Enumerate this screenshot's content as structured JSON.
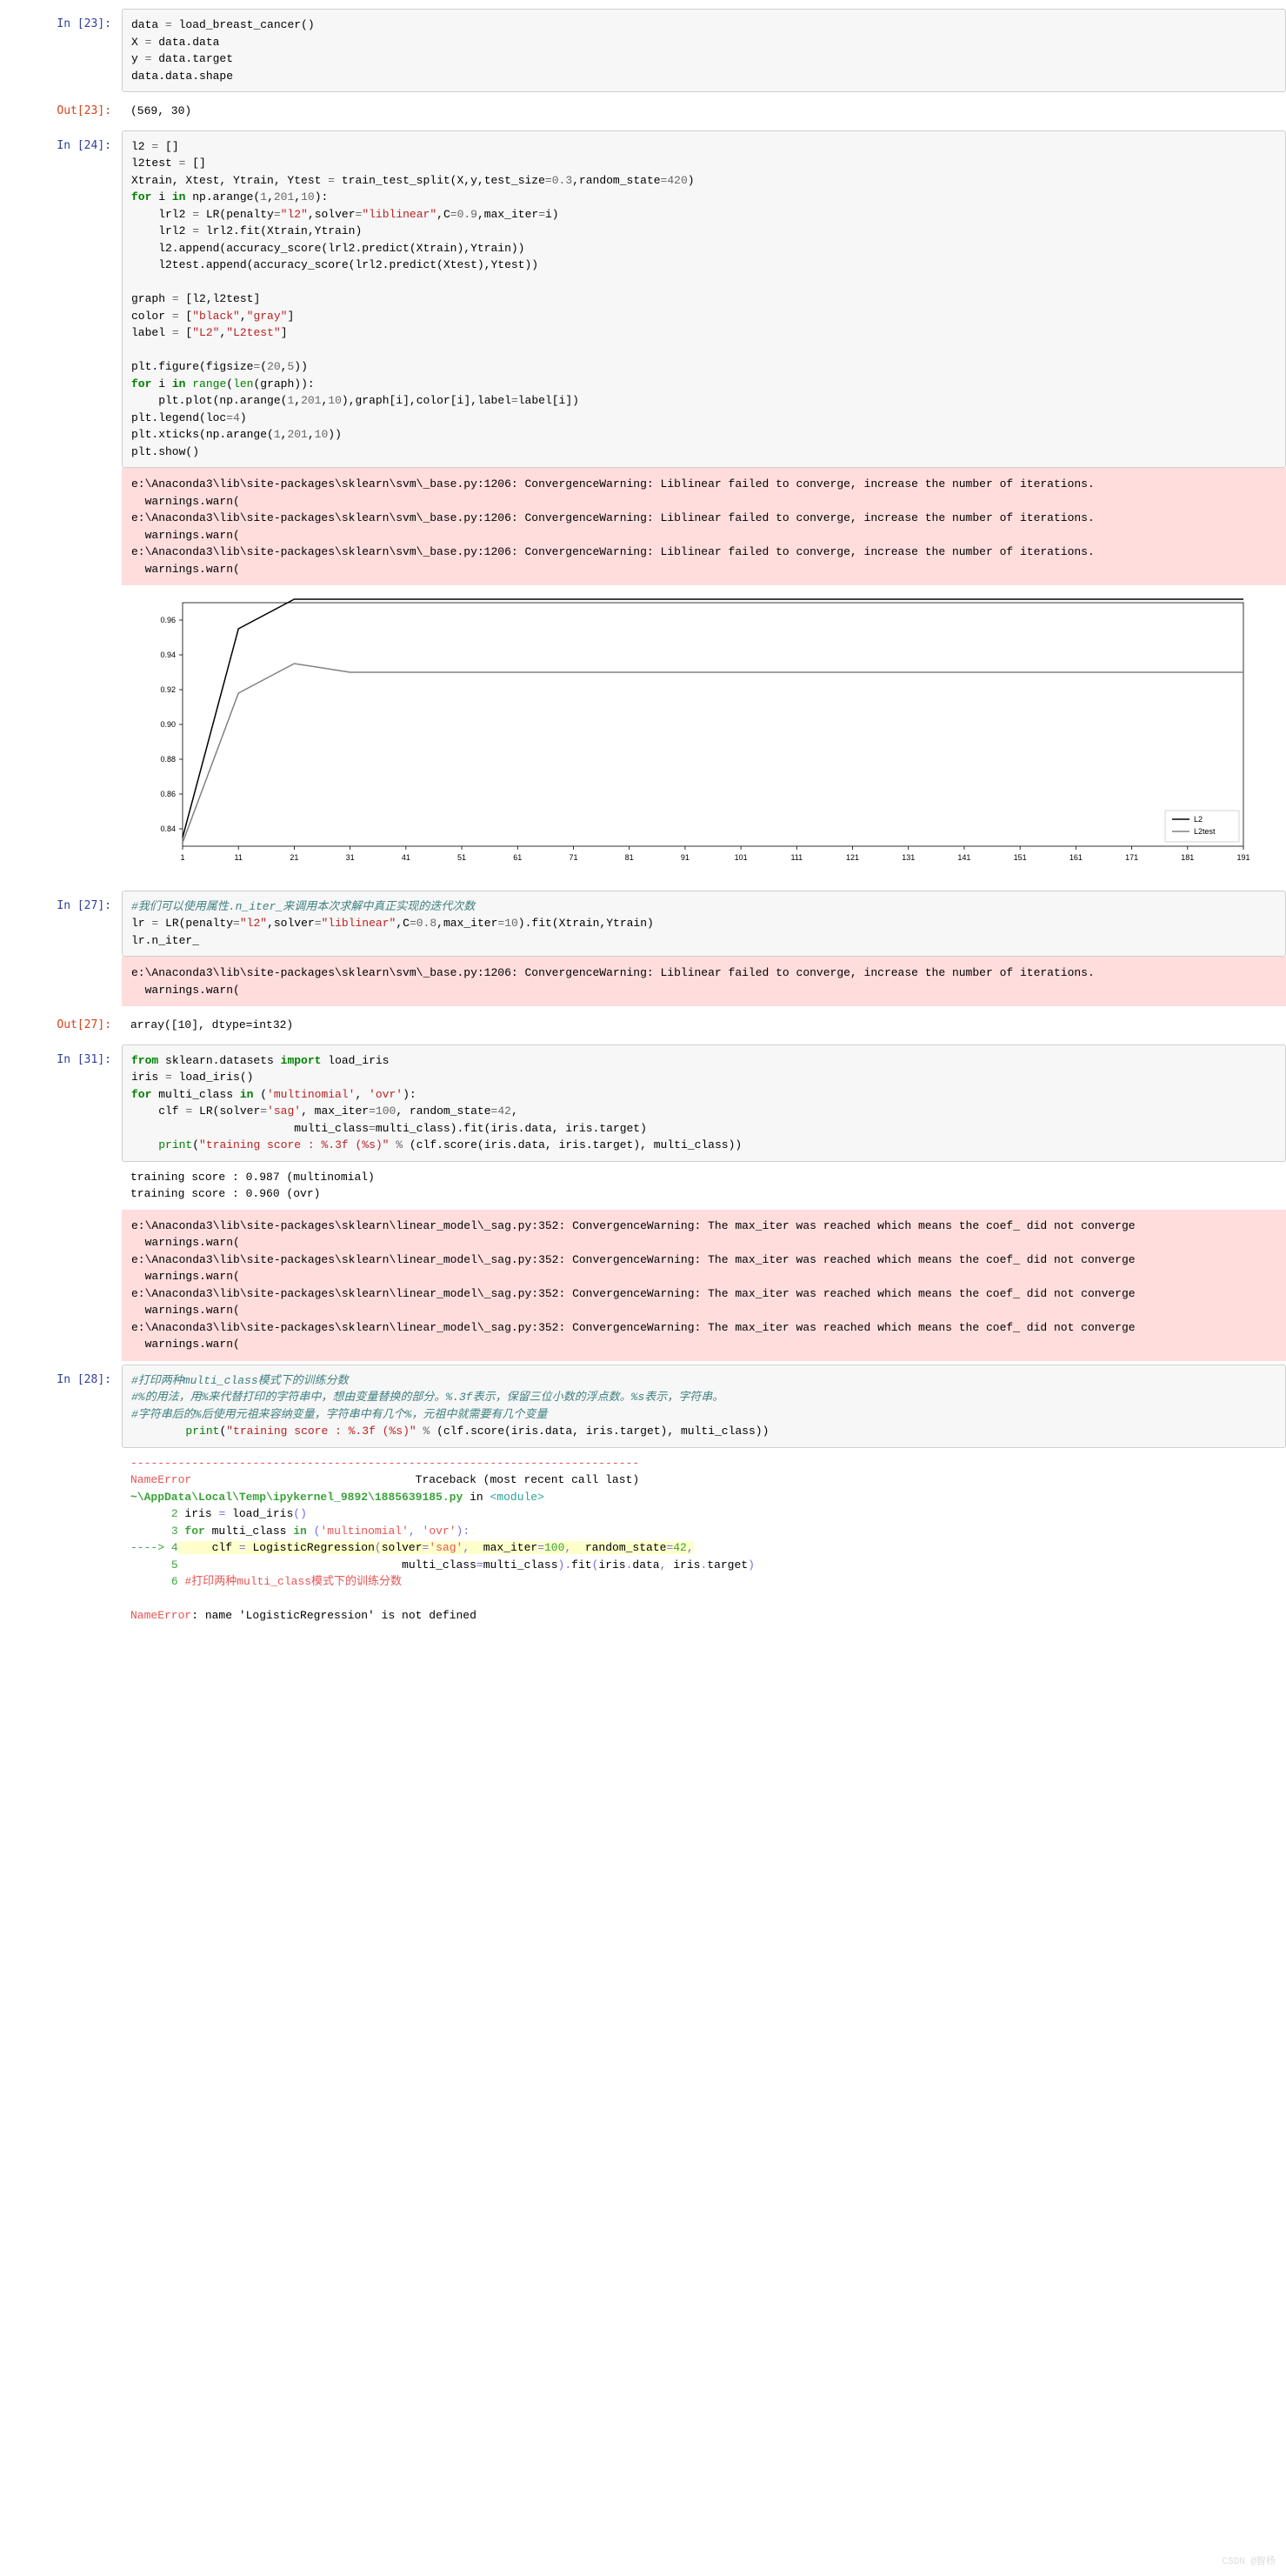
{
  "cells": {
    "c23": {
      "prompt_in": "In  [23]:",
      "prompt_out": "Out[23]:",
      "out": "(569, 30)",
      "code": {
        "l0": {
          "a": "data ",
          "b": "=",
          "c": " load_breast_cancer()"
        },
        "l1": {
          "a": "X ",
          "b": "=",
          "c": " data.data"
        },
        "l2": {
          "a": "y ",
          "b": "=",
          "c": " data.target"
        },
        "l3": {
          "a": "data.data.shape"
        }
      }
    },
    "c24": {
      "prompt_in": "In  [24]:",
      "code": {
        "l0": {
          "a": "l2 ",
          "b": "=",
          "c": " []"
        },
        "l1": {
          "a": "l2test ",
          "b": "=",
          "c": " []"
        },
        "l2": {
          "a": "Xtrain, Xtest, Ytrain, Ytest ",
          "b": "=",
          "c": " train_test_split(X,y,test_size",
          "d": "=",
          "e": "0.3",
          "f": ",random_state",
          "g": "=",
          "h": "420",
          "i": ")"
        },
        "l3": {
          "a": "for",
          "b": " i ",
          "c": "in",
          "d": " np.arange(",
          "e": "1",
          "f": ",",
          "g": "201",
          "h": ",",
          "i": "10",
          "j": "):"
        },
        "l4": {
          "a": "    lrl2 ",
          "b": "=",
          "c": " LR(penalty",
          "d": "=",
          "e": "\"l2\"",
          "f": ",solver",
          "g": "=",
          "h": "\"liblinear\"",
          "i": ",C",
          "j": "=",
          "k": "0.9",
          "l": ",max_iter",
          "m": "=",
          "n": "i)"
        },
        "l5": {
          "a": "    lrl2 ",
          "b": "=",
          "c": " lrl2.fit(Xtrain,Ytrain)"
        },
        "l6": {
          "a": "    l2.append(accuracy_score(lrl2.predict(Xtrain),Ytrain))"
        },
        "l7": {
          "a": "    l2test.append(accuracy_score(lrl2.predict(Xtest),Ytest))"
        },
        "l8": {
          "a": ""
        },
        "l9": {
          "a": "graph ",
          "b": "=",
          "c": " [l2,l2test]"
        },
        "l10": {
          "a": "color ",
          "b": "=",
          "c": " [",
          "d": "\"black\"",
          "e": ",",
          "f": "\"gray\"",
          "g": "]"
        },
        "l11": {
          "a": "label ",
          "b": "=",
          "c": " [",
          "d": "\"L2\"",
          "e": ",",
          "f": "\"L2test\"",
          "g": "]"
        },
        "l12": {
          "a": ""
        },
        "l13": {
          "a": "plt.figure(figsize",
          "b": "=",
          "c": "(",
          "d": "20",
          "e": ",",
          "f": "5",
          "g": "))"
        },
        "l14": {
          "a": "for",
          "b": " i ",
          "c": "in",
          "d": " ",
          "e": "range",
          "f": "(",
          "g": "len",
          "h": "(graph)):"
        },
        "l15": {
          "a": "    plt.plot(np.arange(",
          "b": "1",
          "c": ",",
          "d": "201",
          "e": ",",
          "f": "10",
          "g": "),graph[i],color[i],label",
          "h": "=",
          "i": "label[i])"
        },
        "l16": {
          "a": "plt.legend(loc",
          "b": "=",
          "c": "4",
          "d": ")"
        },
        "l17": {
          "a": "plt.xticks(np.arange(",
          "b": "1",
          "c": ",",
          "d": "201",
          "e": ",",
          "f": "10",
          "g": "))"
        },
        "l18": {
          "a": "plt.show()"
        }
      },
      "stderr": "e:\\Anaconda3\\lib\\site-packages\\sklearn\\svm\\_base.py:1206: ConvergenceWarning: Liblinear failed to converge, increase the number of iterations.\n  warnings.warn(\ne:\\Anaconda3\\lib\\site-packages\\sklearn\\svm\\_base.py:1206: ConvergenceWarning: Liblinear failed to converge, increase the number of iterations.\n  warnings.warn(\ne:\\Anaconda3\\lib\\site-packages\\sklearn\\svm\\_base.py:1206: ConvergenceWarning: Liblinear failed to converge, increase the number of iterations.\n  warnings.warn("
    },
    "c27": {
      "prompt_in": "In  [27]:",
      "prompt_out": "Out[27]:",
      "code": {
        "l0": {
          "a": "#我们可以使用属性.n_iter_来调用本次求解中真正实现的迭代次数"
        },
        "l1": {
          "a": "lr ",
          "b": "=",
          "c": " LR(penalty",
          "d": "=",
          "e": "\"l2\"",
          "f": ",solver",
          "g": "=",
          "h": "\"liblinear\"",
          "i": ",C",
          "j": "=",
          "k": "0.8",
          "l": ",max_iter",
          "m": "=",
          "n": "10",
          "o": ").fit(Xtrain,Ytrain)"
        },
        "l2": {
          "a": "lr.n_iter_"
        }
      },
      "stderr": "e:\\Anaconda3\\lib\\site-packages\\sklearn\\svm\\_base.py:1206: ConvergenceWarning: Liblinear failed to converge, increase the number of iterations.\n  warnings.warn(",
      "out": "array([10], dtype=int32)"
    },
    "c31": {
      "prompt_in": "In  [31]:",
      "code": {
        "l0": {
          "a": "from",
          "b": " sklearn.datasets ",
          "c": "import",
          "d": " load_iris"
        },
        "l1": {
          "a": "iris ",
          "b": "=",
          "c": " load_iris()"
        },
        "l2": {
          "a": "for",
          "b": " multi_class ",
          "c": "in",
          "d": " (",
          "e": "'multinomial'",
          "f": ", ",
          "g": "'ovr'",
          "h": "):"
        },
        "l3": {
          "a": "    clf ",
          "b": "=",
          "c": " LR(solver",
          "d": "=",
          "e": "'sag'",
          "f": ", max_iter",
          "g": "=",
          "h": "100",
          "i": ", random_state",
          "j": "=",
          "k": "42",
          "l": ","
        },
        "l4": {
          "a": "                        multi_class",
          "b": "=",
          "c": "multi_class).fit(iris.data, iris.target)"
        },
        "l5": {
          "a": "    ",
          "b": "print",
          "c": "(",
          "d": "\"training score : %.3f (%s)\"",
          "e": " ",
          "f": "%",
          "g": " (clf.score(iris.data, iris.target), multi_class))"
        }
      },
      "stdout": "training score : 0.987 (multinomial)\ntraining score : 0.960 (ovr)",
      "stderr": "e:\\Anaconda3\\lib\\site-packages\\sklearn\\linear_model\\_sag.py:352: ConvergenceWarning: The max_iter was reached which means the coef_ did not converge\n  warnings.warn(\ne:\\Anaconda3\\lib\\site-packages\\sklearn\\linear_model\\_sag.py:352: ConvergenceWarning: The max_iter was reached which means the coef_ did not converge\n  warnings.warn(\ne:\\Anaconda3\\lib\\site-packages\\sklearn\\linear_model\\_sag.py:352: ConvergenceWarning: The max_iter was reached which means the coef_ did not converge\n  warnings.warn(\ne:\\Anaconda3\\lib\\site-packages\\sklearn\\linear_model\\_sag.py:352: ConvergenceWarning: The max_iter was reached which means the coef_ did not converge\n  warnings.warn("
    },
    "c28": {
      "prompt_in": "In  [28]:",
      "code": {
        "l0": {
          "a": "#打印两种multi_class模式下的训练分数"
        },
        "l1": {
          "a": "#%的用法，用%来代替打印的字符串中，想由变量替换的部分。%.3f表示，保留三位小数的浮点数。%s表示，字符串。"
        },
        "l2": {
          "a": "#字符串后的%后使用元祖来容纳变量，字符串中有几个%，元祖中就需要有几个变量"
        },
        "l3": {
          "pad": "        ",
          "a": "print",
          "b": "(",
          "c": "\"training score : %.3f (%s)\"",
          "d": " ",
          "e": "%",
          "f": " (clf.score(iris.data, iris.target), multi_class))"
        }
      },
      "trace": {
        "sep": "---------------------------------------------------------------------------",
        "head_left": "NameError",
        "head_right": "Traceback (most recent call last)",
        "file": "~\\AppData\\Local\\Temp\\ipykernel_9892\\1885639185.py",
        "in": " in ",
        "mod": "<module>",
        "l2": {
          "n": "      2 ",
          "a": "iris ",
          "b": "=",
          "c": " load_iris",
          "d": "()"
        },
        "l3": {
          "n": "      3 ",
          "a": "for",
          "b": " multi_class ",
          "c": "in",
          "d": " ",
          "e": "(",
          "f": "'multinomial'",
          "g": ",",
          "h": " ",
          "i": "'ovr'",
          "j": ")",
          "k": ":"
        },
        "l4": {
          "arrow": "----> ",
          "n": "4",
          "pad": "     ",
          "a": "clf ",
          "b": "=",
          "c": " LogisticRegression",
          "d": "(",
          "e": "solver",
          "f": "=",
          "g": "'sag'",
          "h": ",",
          "i": "  max_iter",
          "j": "=",
          "k": "100",
          "l": ",",
          "m": "  random_state",
          "n2": "=",
          "o": "42",
          "p": ","
        },
        "l5": {
          "n": "      5 ",
          "pad": "                                ",
          "a": "multi_class",
          "b": "=",
          "c": "multi_class",
          "d": ")",
          "e": ".",
          "f": "fit",
          "g": "(",
          "h": "iris",
          "i": ".",
          "j": "data",
          "k": ",",
          "l": " iris",
          "m": ".",
          "n2": "target",
          "o": ")"
        },
        "l6": {
          "n": "      6 ",
          "a": "#打印两种multi_class模式下的训练分数"
        },
        "foot": {
          "a": "NameError",
          "b": ": name 'LogisticRegression' is not defined"
        }
      }
    }
  },
  "chart_data": {
    "type": "line",
    "x": [
      1,
      11,
      21,
      31,
      41,
      51,
      61,
      71,
      81,
      91,
      101,
      111,
      121,
      131,
      141,
      151,
      161,
      171,
      181,
      191
    ],
    "series": [
      {
        "name": "L2",
        "color": "#000000",
        "values": [
          0.835,
          0.955,
          0.972,
          0.972,
          0.972,
          0.972,
          0.972,
          0.972,
          0.972,
          0.972,
          0.972,
          0.972,
          0.972,
          0.972,
          0.972,
          0.972,
          0.972,
          0.972,
          0.972,
          0.972
        ]
      },
      {
        "name": "L2test",
        "color": "#808080",
        "values": [
          0.832,
          0.918,
          0.935,
          0.93,
          0.93,
          0.93,
          0.93,
          0.93,
          0.93,
          0.93,
          0.93,
          0.93,
          0.93,
          0.93,
          0.93,
          0.93,
          0.93,
          0.93,
          0.93,
          0.93
        ]
      }
    ],
    "ylim": [
      0.83,
      0.97
    ],
    "yticks": [
      0.84,
      0.86,
      0.88,
      0.9,
      0.92,
      0.94,
      0.96
    ],
    "legend_pos": "lower right"
  },
  "watermark": "CSDN @智杨"
}
